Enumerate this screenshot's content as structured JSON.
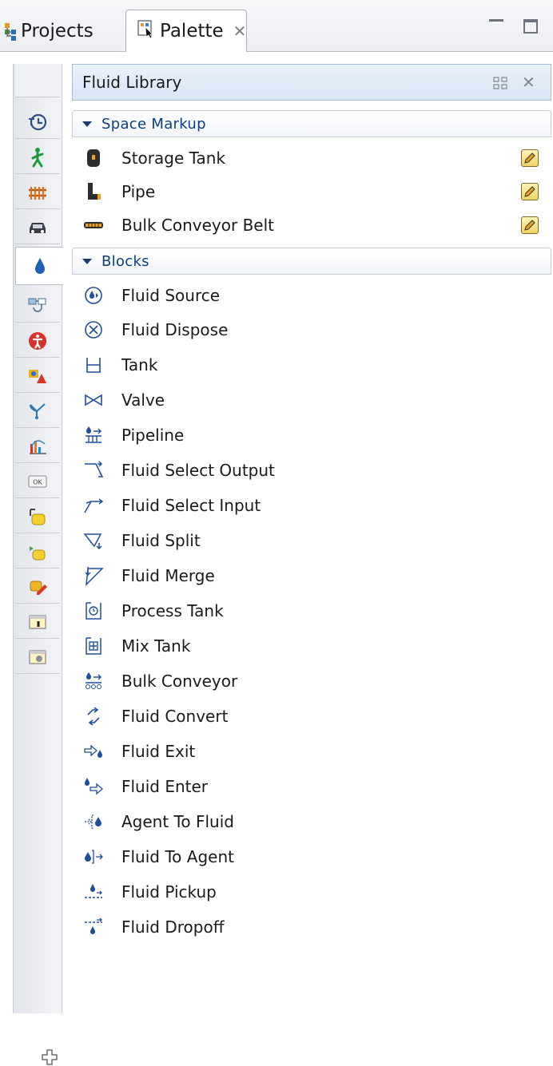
{
  "tabs": [
    {
      "label": "Projects",
      "icon": "projects-tree-icon"
    },
    {
      "label": "Palette",
      "icon": "palette-icon",
      "active": true
    }
  ],
  "rail": {
    "items": [
      {
        "name": "history-icon"
      },
      {
        "name": "pedestrian-icon"
      },
      {
        "name": "rail-track-icon"
      },
      {
        "name": "car-icon"
      },
      {
        "name": "fluid-drop-icon",
        "active": true
      },
      {
        "name": "process-flow-icon"
      },
      {
        "name": "accessibility-icon"
      },
      {
        "name": "shapes-icon"
      },
      {
        "name": "statechart-icon"
      },
      {
        "name": "analysis-chart-icon"
      },
      {
        "name": "ok-button-control-icon"
      },
      {
        "name": "agent-yellow-icon"
      },
      {
        "name": "agent-green-icon"
      },
      {
        "name": "agent-edit-icon"
      },
      {
        "name": "experiment-icon"
      },
      {
        "name": "folder-image-icon"
      }
    ],
    "add_icon": "plus-icon"
  },
  "library": {
    "title": "Fluid Library"
  },
  "sections": [
    {
      "title": "Space Markup",
      "items": [
        {
          "label": "Storage Tank",
          "icon": "storage-tank-icon",
          "editable": true
        },
        {
          "label": "Pipe",
          "icon": "pipe-icon",
          "editable": true
        },
        {
          "label": "Bulk Conveyor Belt",
          "icon": "conveyor-belt-icon",
          "editable": true
        }
      ]
    },
    {
      "title": "Blocks",
      "items": [
        {
          "label": "Fluid Source",
          "icon": "fluid-source-icon"
        },
        {
          "label": "Fluid Dispose",
          "icon": "fluid-dispose-icon"
        },
        {
          "label": "Tank",
          "icon": "tank-icon"
        },
        {
          "label": "Valve",
          "icon": "valve-icon"
        },
        {
          "label": "Pipeline",
          "icon": "pipeline-icon"
        },
        {
          "label": "Fluid Select Output",
          "icon": "select-output-icon"
        },
        {
          "label": "Fluid Select Input",
          "icon": "select-input-icon"
        },
        {
          "label": "Fluid Split",
          "icon": "fluid-split-icon"
        },
        {
          "label": "Fluid Merge",
          "icon": "fluid-merge-icon"
        },
        {
          "label": "Process Tank",
          "icon": "process-tank-icon"
        },
        {
          "label": "Mix Tank",
          "icon": "mix-tank-icon"
        },
        {
          "label": "Bulk Conveyor",
          "icon": "bulk-conveyor-icon"
        },
        {
          "label": "Fluid Convert",
          "icon": "fluid-convert-icon"
        },
        {
          "label": "Fluid Exit",
          "icon": "fluid-exit-icon"
        },
        {
          "label": "Fluid Enter",
          "icon": "fluid-enter-icon"
        },
        {
          "label": "Agent To Fluid",
          "icon": "agent-to-fluid-icon"
        },
        {
          "label": "Fluid To Agent",
          "icon": "fluid-to-agent-icon"
        },
        {
          "label": "Fluid Pickup",
          "icon": "fluid-pickup-icon"
        },
        {
          "label": "Fluid Dropoff",
          "icon": "fluid-dropoff-icon"
        }
      ]
    }
  ]
}
